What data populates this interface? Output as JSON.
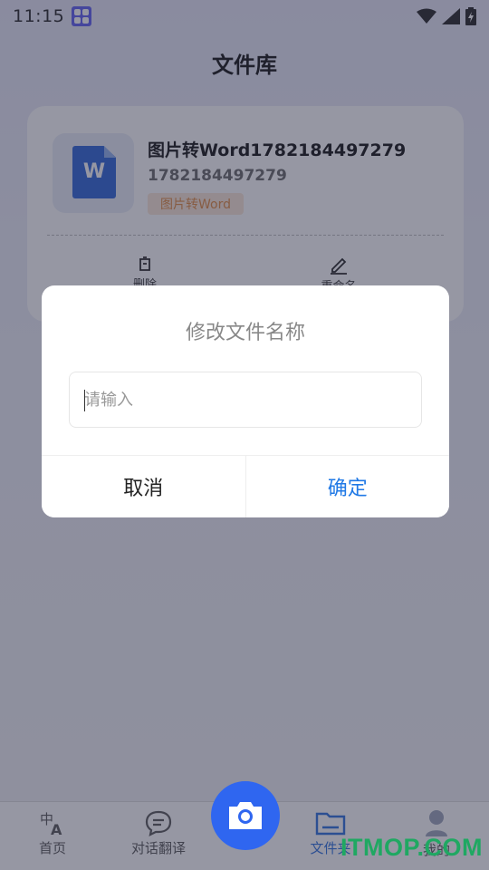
{
  "status": {
    "time": "11:15",
    "app_icon": "app-grid-icon",
    "icons": [
      "wifi-icon",
      "signal-icon",
      "battery-charging-icon"
    ]
  },
  "header": {
    "title": "文件库"
  },
  "file_card": {
    "name": "图片转Word1782184497279",
    "id": "1782184497279",
    "tag": "图片转Word",
    "thumb_letter": "W",
    "actions": [
      {
        "label": "删除",
        "icon": "trash-icon"
      },
      {
        "label": "重命名",
        "icon": "pencil-icon"
      }
    ]
  },
  "dialog": {
    "title": "修改文件名称",
    "input_placeholder": "请输入",
    "input_value": "",
    "cancel_label": "取消",
    "confirm_label": "确定"
  },
  "nav": {
    "items": [
      {
        "label": "首页",
        "icon": "translate-icon"
      },
      {
        "label": "对话翻译",
        "icon": "chat-icon"
      },
      {
        "label": "文件夹",
        "icon": "folder-icon",
        "active": true
      },
      {
        "label": "我的",
        "icon": "user-icon"
      }
    ],
    "camera_icon": "camera-icon"
  },
  "colors": {
    "accent": "#2079e6",
    "camera": "#2f66f0",
    "word_blue": "#2a63d6",
    "tag_orange": "#e0893f"
  },
  "watermark": "ITMOP.COM"
}
